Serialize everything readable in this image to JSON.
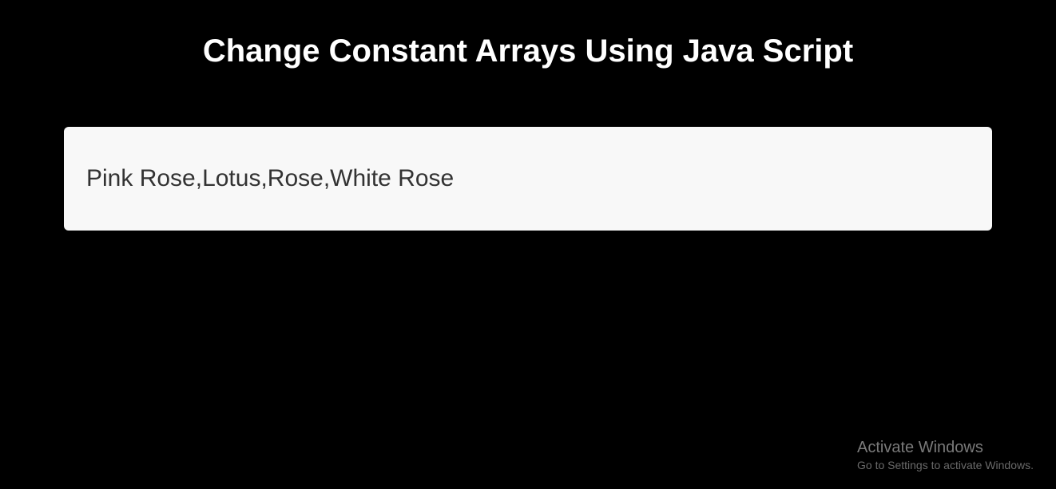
{
  "header": {
    "title": "Change Constant Arrays Using Java Script"
  },
  "output": {
    "text": "Pink Rose,Lotus,Rose,White Rose"
  },
  "watermark": {
    "title": "Activate Windows",
    "subtitle": "Go to Settings to activate Windows."
  }
}
